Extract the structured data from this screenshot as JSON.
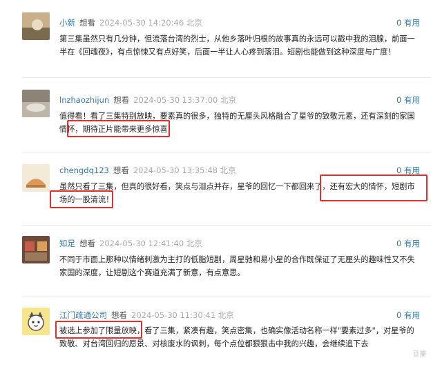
{
  "comments": [
    {
      "user": "小新",
      "rating": "想看",
      "time": "2024-05-30 14:20:46 北京",
      "useful": "0 有用",
      "text": "第三集虽然只有几分钟，但流落台湾的烈士，从他乡落叶归根的故事真的永远可以戳中我的泪腺，前面一半在《回魂夜》，有点惊悚又有点好笑，后面一半让人心疼到落泪。短剧也能做到这种深度与广度！"
    },
    {
      "user": "lnzhaozhijun",
      "rating": "想看",
      "time": "2024-05-30 13:37:00 北京",
      "useful": "0 有用",
      "text": "值得看！看了三集特别放映，要素真的很多，独特的无厘头风格融合了星爷的致敬元素，还有深刻的家国情怀，期待正片能带来更多惊喜！"
    },
    {
      "user": "chengdq123",
      "rating": "想看",
      "time": "2024-05-30 13:35:48 北京",
      "useful": "0 有用",
      "text": "虽然只看了三集，但真的很好看，笑点与泪点并存，星爷的回忆一下都回来了，还有宏大的情怀，短剧市场的一股清流！"
    },
    {
      "user": "知足",
      "rating": "想看",
      "time": "2024-05-30 12:41:40 北京",
      "useful": "0 有用",
      "text": "不同于市面上那种以情绪刺激为主打的低脂短剧，周星驰和易小星的合作既保证了无厘头的趣味性又不失家国的深度，让短剧这个赛道充满了新意，有点意思。"
    },
    {
      "user": "江门疏通公司",
      "rating": "想看",
      "time": "2024-05-30 11:30:41 北京",
      "useful": "0 有用",
      "text": "被选上参加了限量放映，看了三集，紧凑有趣，笑点密集，也确实像活动名称一样\"要素过多\"，对星爷的致敬、对台湾回归的愿景、对核废水的讽刺，每个点位都狠狠击中我的兴趣，会继续追下去"
    }
  ],
  "colors": {
    "link": "#3377aa",
    "highlight": "#e0302b",
    "divider": "#e8e8e8"
  },
  "watermark": "豆瓣"
}
